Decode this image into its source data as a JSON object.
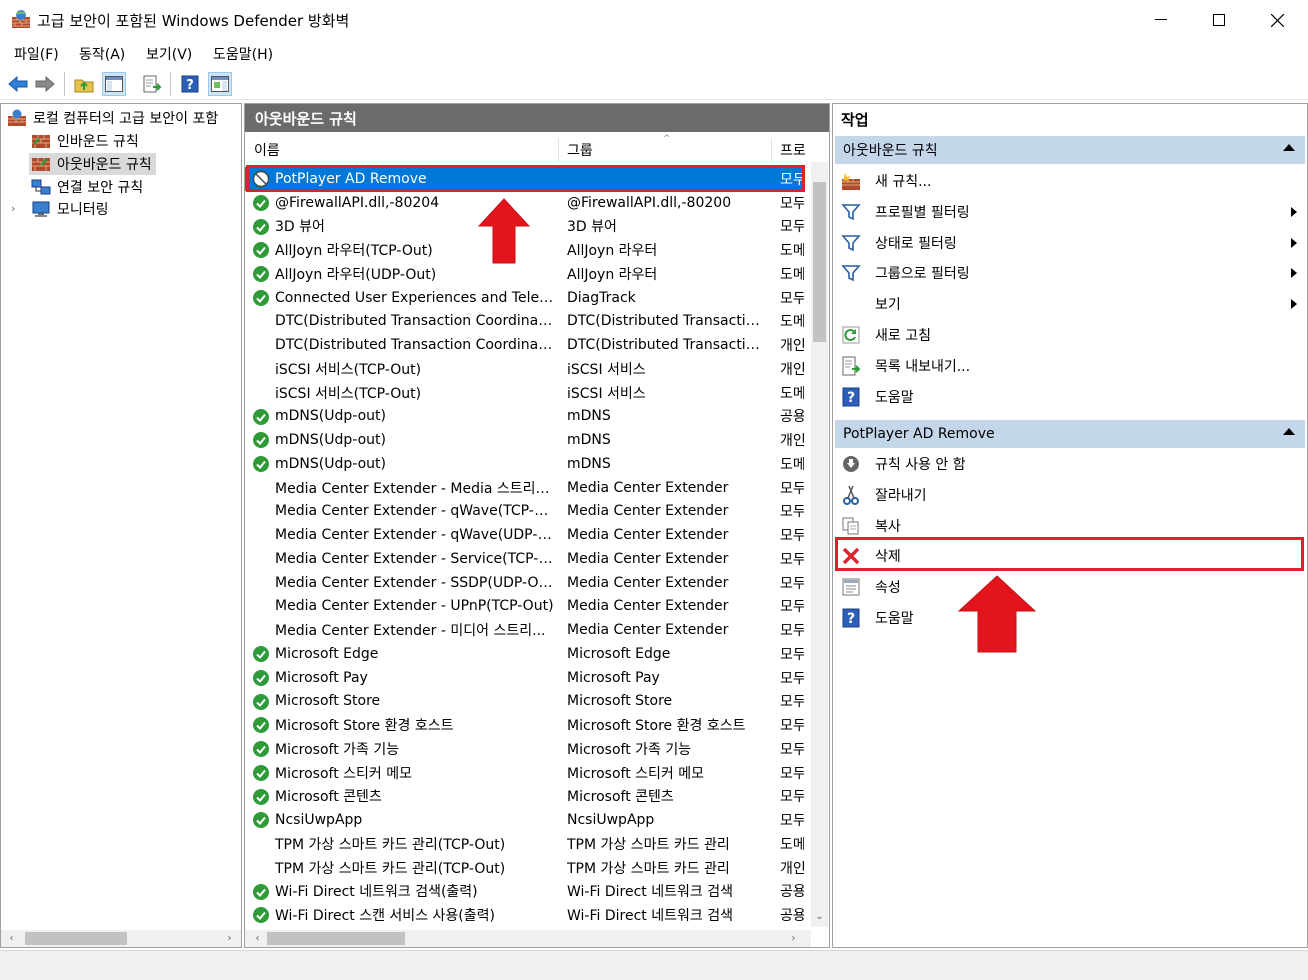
{
  "window": {
    "title": "고급 보안이 포함된 Windows Defender 방화벽",
    "minimize": "—",
    "maximize": "☐",
    "close": "✕"
  },
  "menu": [
    "파일(F)",
    "동작(A)",
    "보기(V)",
    "도움말(H)"
  ],
  "toolbar": [
    "back-arrow-icon",
    "forward-arrow-icon",
    "folder-up-icon",
    "show-tree-icon",
    "export-icon",
    "help-icon",
    "show-action-pane-icon"
  ],
  "tree": {
    "root": "로컬 컴퓨터의 고급 보안이 포함",
    "items": [
      "인바운드 규칙",
      "아웃바운드 규칙",
      "연결 보안 규칙",
      "모니터링"
    ],
    "selected": "아웃바운드 규칙"
  },
  "middle": {
    "header": "아웃바운드 규칙",
    "columns": [
      "이름",
      "그룹",
      "프로"
    ],
    "rows": [
      {
        "icon": "blocked",
        "name": "PotPlayer AD Remove",
        "group": "",
        "profile": "모두"
      },
      {
        "icon": "ok",
        "name": "@FirewallAPI.dll,-80204",
        "group": "@FirewallAPI.dll,-80200",
        "profile": "모두"
      },
      {
        "icon": "ok",
        "name": "3D 뷰어",
        "group": "3D 뷰어",
        "profile": "모두"
      },
      {
        "icon": "ok",
        "name": "AllJoyn 라우터(TCP-Out)",
        "group": "AllJoyn 라우터",
        "profile": "도메"
      },
      {
        "icon": "ok",
        "name": "AllJoyn 라우터(UDP-Out)",
        "group": "AllJoyn 라우터",
        "profile": "도메"
      },
      {
        "icon": "ok",
        "name": "Connected User Experiences and Telemetry",
        "group": "DiagTrack",
        "profile": "모두"
      },
      {
        "icon": "none",
        "name": "DTC(Distributed Transaction Coordinator)...",
        "group": "DTC(Distributed Transaction ...",
        "profile": "도메"
      },
      {
        "icon": "none",
        "name": "DTC(Distributed Transaction Coordinator)...",
        "group": "DTC(Distributed Transaction ...",
        "profile": "개인"
      },
      {
        "icon": "none",
        "name": "iSCSI 서비스(TCP-Out)",
        "group": "iSCSI 서비스",
        "profile": "개인"
      },
      {
        "icon": "none",
        "name": "iSCSI 서비스(TCP-Out)",
        "group": "iSCSI 서비스",
        "profile": "도메"
      },
      {
        "icon": "ok",
        "name": "mDNS(Udp-out)",
        "group": "mDNS",
        "profile": "공용"
      },
      {
        "icon": "ok",
        "name": "mDNS(Udp-out)",
        "group": "mDNS",
        "profile": "개인"
      },
      {
        "icon": "ok",
        "name": "mDNS(Udp-out)",
        "group": "mDNS",
        "profile": "도메"
      },
      {
        "icon": "none",
        "name": "Media Center Extender - Media 스트리밍...",
        "group": "Media Center Extender",
        "profile": "모두"
      },
      {
        "icon": "none",
        "name": "Media Center Extender - qWave(TCP-Out)",
        "group": "Media Center Extender",
        "profile": "모두"
      },
      {
        "icon": "none",
        "name": "Media Center Extender - qWave(UDP-Out)",
        "group": "Media Center Extender",
        "profile": "모두"
      },
      {
        "icon": "none",
        "name": "Media Center Extender - Service(TCP-Out)",
        "group": "Media Center Extender",
        "profile": "모두"
      },
      {
        "icon": "none",
        "name": "Media Center Extender - SSDP(UDP-Out)",
        "group": "Media Center Extender",
        "profile": "모두"
      },
      {
        "icon": "none",
        "name": "Media Center Extender - UPnP(TCP-Out)",
        "group": "Media Center Extender",
        "profile": "모두"
      },
      {
        "icon": "none",
        "name": "Media Center Extender - 미디어 스트리...",
        "group": "Media Center Extender",
        "profile": "모두"
      },
      {
        "icon": "ok",
        "name": "Microsoft Edge",
        "group": "Microsoft Edge",
        "profile": "모두"
      },
      {
        "icon": "ok",
        "name": "Microsoft Pay",
        "group": "Microsoft Pay",
        "profile": "모두"
      },
      {
        "icon": "ok",
        "name": "Microsoft Store",
        "group": "Microsoft Store",
        "profile": "모두"
      },
      {
        "icon": "ok",
        "name": "Microsoft Store 환경 호스트",
        "group": "Microsoft Store 환경 호스트",
        "profile": "모두"
      },
      {
        "icon": "ok",
        "name": "Microsoft 가족 기능",
        "group": "Microsoft 가족 기능",
        "profile": "모두"
      },
      {
        "icon": "ok",
        "name": "Microsoft 스티커 메모",
        "group": "Microsoft 스티커 메모",
        "profile": "모두"
      },
      {
        "icon": "ok",
        "name": "Microsoft 콘텐츠",
        "group": "Microsoft 콘텐츠",
        "profile": "모두"
      },
      {
        "icon": "ok",
        "name": "NcsiUwpApp",
        "group": "NcsiUwpApp",
        "profile": "모두"
      },
      {
        "icon": "none",
        "name": "TPM 가상 스마트 카드 관리(TCP-Out)",
        "group": "TPM 가상 스마트 카드 관리",
        "profile": "도메"
      },
      {
        "icon": "none",
        "name": "TPM 가상 스마트 카드 관리(TCP-Out)",
        "group": "TPM 가상 스마트 카드 관리",
        "profile": "개인"
      },
      {
        "icon": "ok",
        "name": "Wi-Fi Direct 네트워크 검색(출력)",
        "group": "Wi-Fi Direct 네트워크 검색",
        "profile": "공용"
      },
      {
        "icon": "ok",
        "name": "Wi-Fi Direct 스캔 서비스 사용(출력)",
        "group": "Wi-Fi Direct 네트워크 검색",
        "profile": "공용"
      }
    ]
  },
  "actions": {
    "title": "작업",
    "section1": {
      "label": "아웃바운드 규칙",
      "items": [
        {
          "label": "새 규칙...",
          "icon": "new-rule-icon",
          "submenu": false
        },
        {
          "label": "프로필별 필터링",
          "icon": "filter-icon",
          "submenu": true
        },
        {
          "label": "상태로 필터링",
          "icon": "filter-icon",
          "submenu": true
        },
        {
          "label": "그룹으로 필터링",
          "icon": "filter-icon",
          "submenu": true
        },
        {
          "label": "보기",
          "icon": "",
          "submenu": true
        },
        {
          "label": "새로 고침",
          "icon": "refresh-icon",
          "submenu": false
        },
        {
          "label": "목록 내보내기...",
          "icon": "export-list-icon",
          "submenu": false
        },
        {
          "label": "도움말",
          "icon": "help-icon",
          "submenu": false
        }
      ]
    },
    "section2": {
      "label": "PotPlayer AD Remove",
      "items": [
        {
          "label": "규칙 사용 안 함",
          "icon": "disable-rule-icon"
        },
        {
          "label": "잘라내기",
          "icon": "cut-icon"
        },
        {
          "label": "복사",
          "icon": "copy-icon"
        },
        {
          "label": "삭제",
          "icon": "delete-icon"
        },
        {
          "label": "속성",
          "icon": "properties-icon"
        },
        {
          "label": "도움말",
          "icon": "help-icon"
        }
      ]
    }
  },
  "colors": {
    "selection": "#0078d7",
    "section_bg": "#c3d6ea",
    "pane_header": "#6b6b6b",
    "highlight": "#e0202c",
    "ok_green": "#2e9b38"
  }
}
